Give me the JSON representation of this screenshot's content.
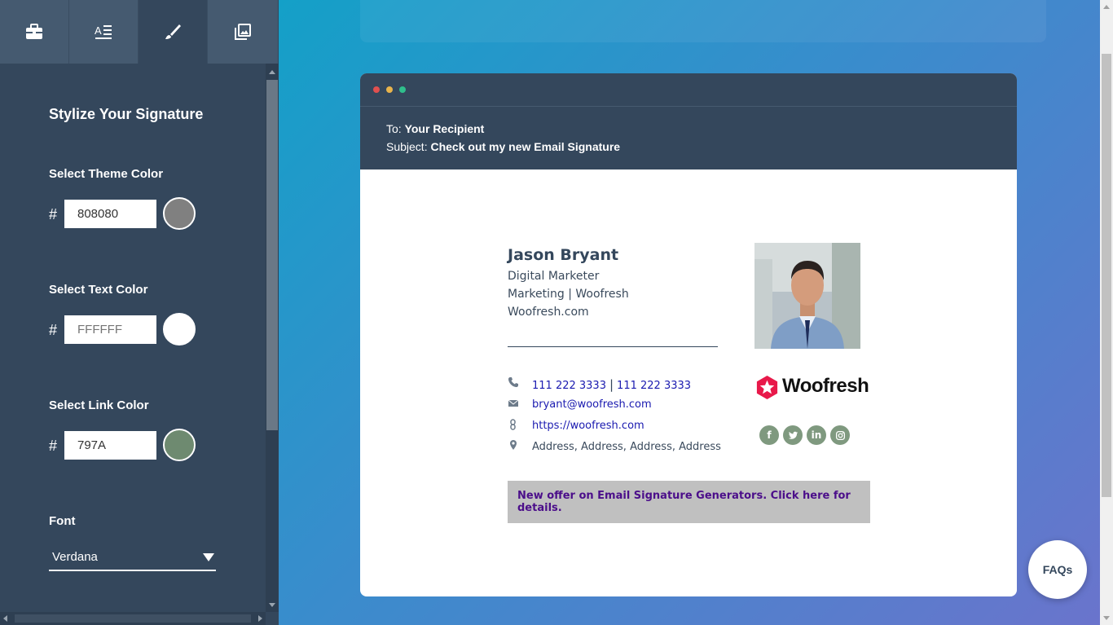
{
  "sidebar": {
    "tabs": [
      {
        "name": "tab-templates",
        "icon": "briefcase-icon"
      },
      {
        "name": "tab-details",
        "icon": "text-format-icon"
      },
      {
        "name": "tab-style",
        "icon": "brush-icon"
      },
      {
        "name": "tab-images",
        "icon": "image-gallery-icon"
      }
    ],
    "active_tab": 2,
    "title": "Stylize Your Signature",
    "theme_color": {
      "label": "Select Theme Color",
      "hash": "#",
      "value": "808080",
      "swatch": "#808080"
    },
    "text_color": {
      "label": "Select Text Color",
      "hash": "#",
      "placeholder": "FFFFFF",
      "swatch": "#FFFFFF"
    },
    "link_color": {
      "label": "Select Link Color",
      "hash": "#",
      "value": "797A",
      "swatch": "#6e8a70"
    },
    "font": {
      "label": "Font",
      "value": "Verdana"
    }
  },
  "email": {
    "to_label": "To:",
    "to_value": "Your Recipient",
    "subject_label": "Subject:",
    "subject_value": "Check out my new Email Signature",
    "dot_colors": [
      "#e0504f",
      "#e8b44c",
      "#2fbf8c"
    ]
  },
  "signature": {
    "name": "Jason Bryant",
    "title": "Digital Marketer",
    "department": "Marketing",
    "company": "Woofresh",
    "website_text": "Woofresh.com",
    "phone1": "111 222 3333",
    "phone2": "111 222 3333",
    "email": "bryant@woofresh.com",
    "url": "https://woofresh.com",
    "address": "Address, Address, Address, Address",
    "logo_text": "Woofresh",
    "socials": [
      "f",
      "t",
      "in",
      "ig"
    ],
    "offer": "New offer on Email Signature Generators. Click here for details."
  },
  "faq_label": "FAQs",
  "colors": {
    "sidebar_bg": "#34475c",
    "header_bg": "#34475c",
    "link": "#1a1ab0",
    "social_bg": "#7f997f",
    "offer_bg": "#c0c0c0",
    "offer_text": "#4b0e8a"
  }
}
